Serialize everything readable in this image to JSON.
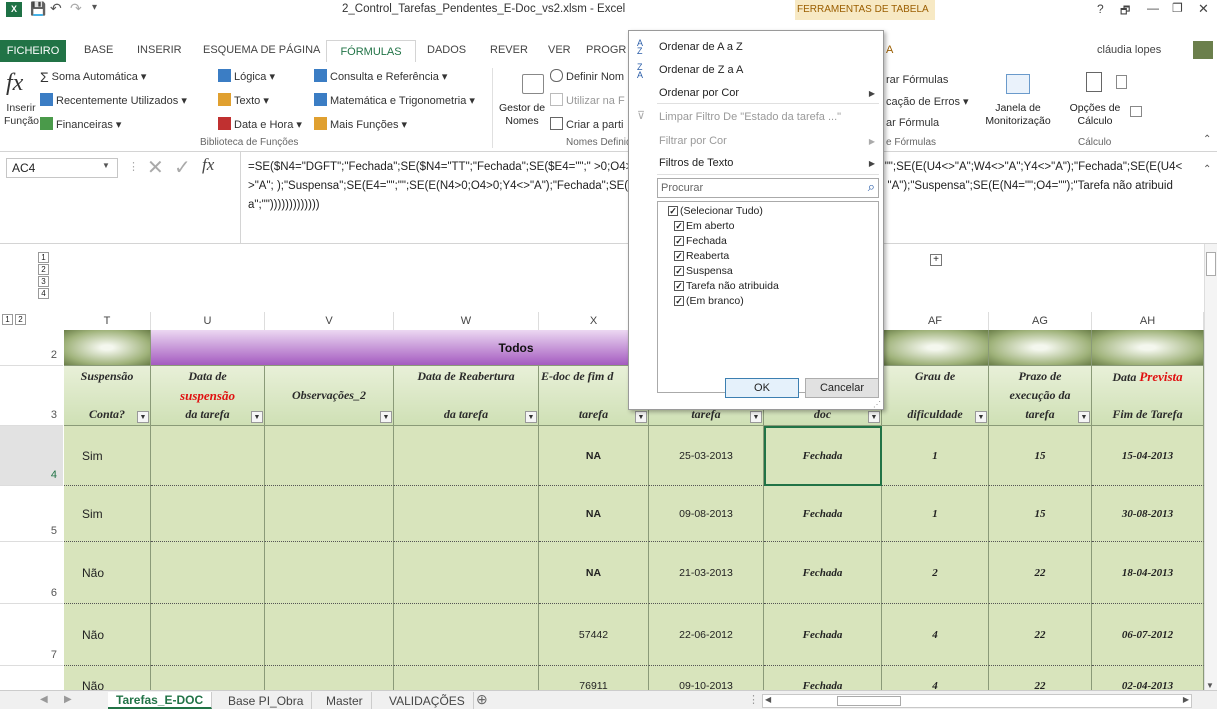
{
  "window": {
    "title": "2_Control_Tarefas_Pendentes_E-Doc_vs2.xlsm - Excel",
    "tools_label": "FERRAMENTAS DE TABELA",
    "user": "cláudia lopes",
    "help": "?",
    "minimize": "—",
    "maximize": "❐",
    "close": "✕",
    "restore": "🗗"
  },
  "quick_access": {
    "save": "💾",
    "undo": "↶",
    "redo": "↷",
    "more": "▾"
  },
  "ribbon_tabs": [
    "FICHEIRO",
    "BASE",
    "INSERIR",
    "ESQUEMA DE PÁGINA",
    "FÓRMULAS",
    "DADOS",
    "REVER",
    "VER",
    "PROGR",
    "A"
  ],
  "ribbon": {
    "insert_fn": "Inserir Função",
    "lib": {
      "autosum": "Soma Automática",
      "recent": "Recentemente Utilizados",
      "financial": "Financeiras",
      "logical": "Lógica",
      "text": "Texto",
      "datetime": "Data e Hora",
      "lookup": "Consulta e Referência",
      "math": "Matemática e Trigonometria",
      "more": "Mais Funções",
      "group": "Biblioteca de Funções"
    },
    "names": {
      "manager": "Gestor de Nomes",
      "define": "Definir Nom",
      "use": "Utilizar na F",
      "create": "Criar a parti",
      "group": "Nomes Definido"
    },
    "audit": {
      "show": "rar Fórmulas",
      "errors": "cação de Erros",
      "eval": "ar Fórmula",
      "group": "e Fórmulas"
    },
    "watch": "Janela de Monitorização",
    "calc": {
      "options": "Opções de Cálculo",
      "group": "Cálculo"
    }
  },
  "formula_bar": {
    "namebox": "AC4",
    "fx": "fx",
    "formula": "=SE($N4=\"DGFT\";\"Fechada\";SE($N4=\"TT\";\"Fechada\";SE($E4=\"\";\"                                                                                 >0;O4>0;U4=\"A\";W4=\"A\";Y4=\"A\");\"Em aberto\";SE(E4=\"\";\"\";SE(E(U4<>\"A\";W4<>\"A\";Y4<>\"A\");\"Fechada\";SE(E(U4<>\"A\";                                                                                 );\"Suspensa\";SE(E4=\"\";\"\";SE(E(N4>0;O4>0;Y4<>\"A\");\"Fechada\";SE(E(N4>\"\";O4>\"\";U4<>\"A\";W4<>\"A\";Y4=\"A\");\"Reabe                                                                                 \"A\");\"Suspensa\";SE(E(N4=\"\";O4=\"\");\"Tarefa não atribuida\";\"\")))))))))))))"
  },
  "outline": {
    "levels": [
      "1",
      "2",
      "3",
      "4"
    ],
    "cols": [
      "1",
      "2"
    ],
    "plus": "+"
  },
  "columns": [
    "T",
    "U",
    "V",
    "W",
    "X",
    "",
    "",
    "AF",
    "AG",
    "AH"
  ],
  "row_numbers": [
    "2",
    "3",
    "4",
    "5",
    "6",
    "7"
  ],
  "banner": "Todos",
  "headers": [
    {
      "top": "Suspensão",
      "bottom": "Conta?"
    },
    {
      "top": "Data de",
      "mid": "suspensão",
      "bottom": "da tarefa"
    },
    {
      "top": "",
      "mid": "Observações_2",
      "bottom": ""
    },
    {
      "top": "Data de Reabertura",
      "bottom": "da tarefa"
    },
    {
      "top": "E-doc de fim d",
      "bottom": "tarefa"
    },
    {
      "top": "",
      "bottom": "tarefa"
    },
    {
      "top": "",
      "bottom": "doc"
    },
    {
      "top": "Grau de",
      "bottom": "dificuldade"
    },
    {
      "top": "Prazo de",
      "mid": "execução da",
      "bottom": "tarefa"
    },
    {
      "top": "Data Prevista",
      "bottom": "Fim de Tarefa"
    }
  ],
  "rows": [
    [
      "Sim",
      "",
      "",
      "",
      "NA",
      "25-03-2013",
      "Fechada",
      "1",
      "15",
      "15-04-2013"
    ],
    [
      "Sim",
      "",
      "",
      "",
      "NA",
      "09-08-2013",
      "Fechada",
      "1",
      "15",
      "30-08-2013"
    ],
    [
      "Não",
      "",
      "",
      "",
      "NA",
      "21-03-2013",
      "Fechada",
      "2",
      "22",
      "18-04-2013"
    ],
    [
      "Não",
      "",
      "",
      "",
      "57442",
      "22-06-2012",
      "Fechada",
      "4",
      "22",
      "06-07-2012"
    ],
    [
      "Não",
      "",
      "",
      "",
      "76911",
      "09-10-2013",
      "Fechada",
      "4",
      "22",
      "02-04-2013"
    ]
  ],
  "sheet_tabs": [
    "Tarefas_E-DOC",
    "Base PI_Obra",
    "Master",
    "VALIDAÇÕES"
  ],
  "add_sheet": "⊕",
  "filter_menu": {
    "sort_az": "Ordenar de A a Z",
    "sort_za": "Ordenar de Z a A",
    "sort_color": "Ordenar por Cor",
    "clear": "Limpar Filtro De \"Estado da tarefa ...\"",
    "filter_color": "Filtrar por Cor",
    "text_filters": "Filtros de Texto",
    "search_placeholder": "Procurar",
    "items": [
      "(Selecionar Tudo)",
      "Em aberto",
      "Fechada",
      "Reaberta",
      "Suspensa",
      "Tarefa não atribuida",
      "(Em branco)"
    ],
    "ok": "OK",
    "cancel": "Cancelar"
  }
}
